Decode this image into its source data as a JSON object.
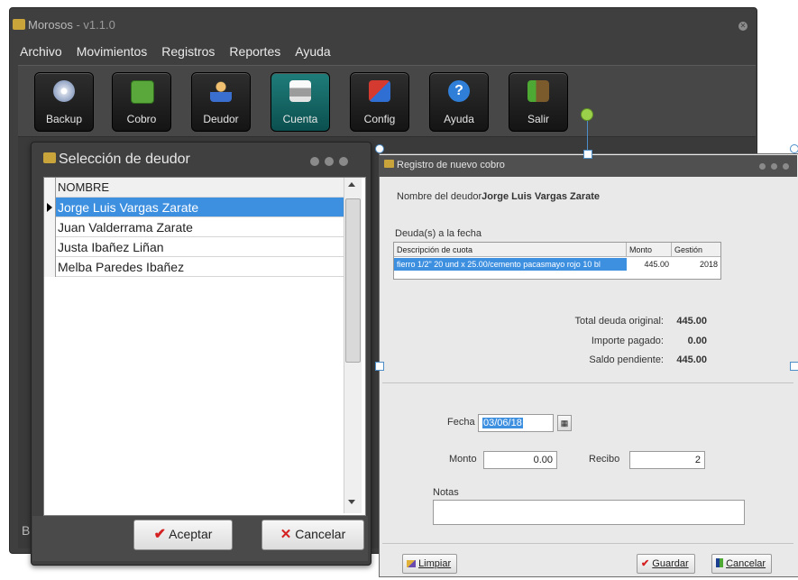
{
  "main_window": {
    "title": "Morosos",
    "version": "- v1.1.0",
    "menu": [
      "Archivo",
      "Movimientos",
      "Registros",
      "Reportes",
      "Ayuda"
    ],
    "toolbar": [
      {
        "label": "Backup",
        "icon": "disc-icon",
        "color": "#cfd7e6"
      },
      {
        "label": "Cobro",
        "icon": "money-add-icon",
        "color": "#5aa83b"
      },
      {
        "label": "Deudor",
        "icon": "user-add-icon",
        "color": "#3a6fd0"
      },
      {
        "label": "Cuenta",
        "icon": "printer-icon",
        "color": "#e4e4e4"
      },
      {
        "label": "Config",
        "icon": "config-tools-icon",
        "color": "#d43a2f"
      },
      {
        "label": "Ayuda",
        "icon": "help-icon",
        "color": "#2f7fd9"
      },
      {
        "label": "Salir",
        "icon": "exit-door-icon",
        "color": "#4da834"
      }
    ],
    "body_letter": "B"
  },
  "selection_dialog": {
    "title": "Selección de deudor",
    "column_header": "NOMBRE",
    "rows": [
      "Jorge Luis Vargas Zarate",
      "Juan Valderrama Zarate",
      "Justa Ibañez Liñan",
      "Melba Paredes Ibañez"
    ],
    "selected_index": 0,
    "accept_label": "Aceptar",
    "cancel_label": "Cancelar"
  },
  "registro_dialog": {
    "title": "Registro de nuevo cobro",
    "debtor_label": "Nombre del deudor",
    "debtor_name": "Jorge Luis Vargas Zarate",
    "debts_label": "Deuda(s) a la fecha",
    "grid_headers": [
      "Descripción de cuota",
      "Monto",
      "Gestión"
    ],
    "grid_row": {
      "descripcion": "fierro 1/2\" 20 und x 25.00/cemento pacasmayo rojo 10 bl",
      "monto": "445.00",
      "gestion": "2018"
    },
    "totals": [
      {
        "label": "Total deuda original:",
        "value": "445.00"
      },
      {
        "label": "Importe pagado:",
        "value": "0.00"
      },
      {
        "label": "Saldo pendiente:",
        "value": "445.00"
      }
    ],
    "fecha_label": "Fecha",
    "fecha_value": "03/06/18",
    "monto_label": "Monto",
    "monto_value": "0.00",
    "recibo_label": "Recibo",
    "recibo_value": "2",
    "notas_label": "Notas",
    "notas_value": "",
    "limpiar_label": "Limpiar",
    "guardar_label": "Guardar",
    "cancelar_label": "Cancelar"
  },
  "colors": {
    "selection": "#3d8fe0",
    "toolbar_active": "#1f7d7a",
    "window_dark": "#3f3f3f"
  }
}
